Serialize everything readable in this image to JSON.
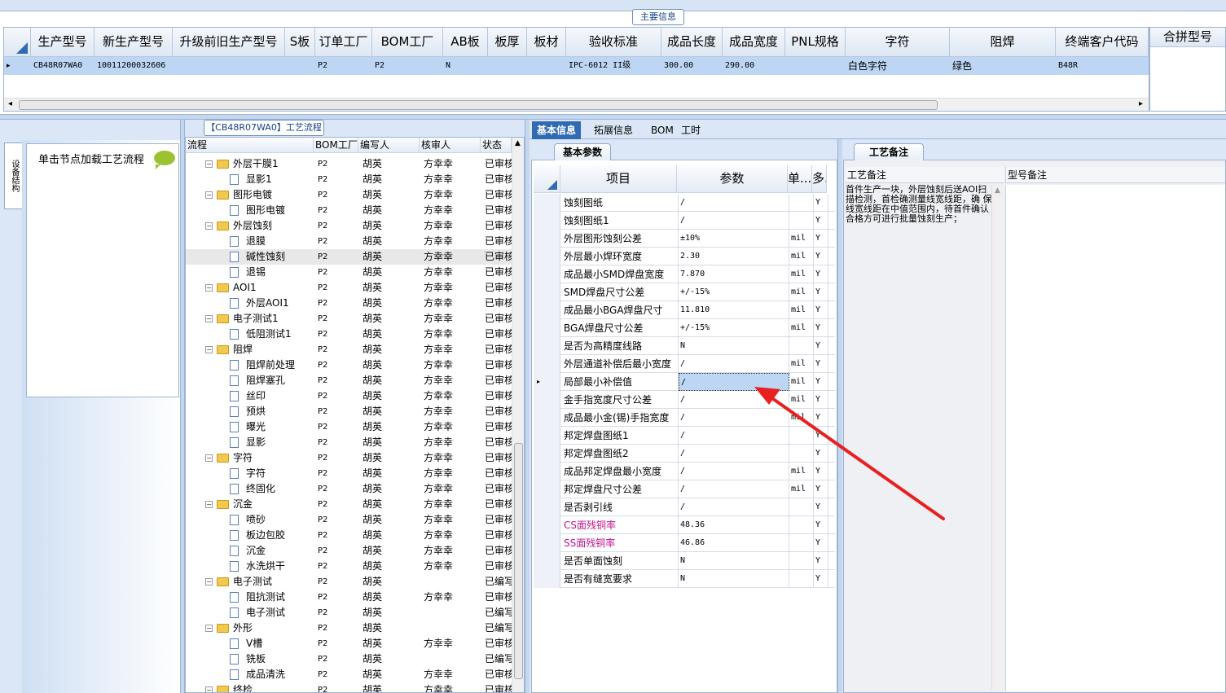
{
  "top": {
    "legend": "主要信息",
    "headers": [
      "生产型号",
      "新生产型号",
      "升级前旧生产型号",
      "S板",
      "订单工厂",
      "BOM工厂",
      "AB板",
      "板厚",
      "板材",
      "验收标准",
      "成品长度",
      "成品宽度",
      "PNL规格",
      "字符",
      "阻焊",
      "终端客户代码"
    ],
    "row": [
      "CB48R07WA0",
      "10011200032606",
      "",
      "",
      "P2",
      "P2",
      "N",
      "",
      "",
      "IPC-6012 II级",
      "300.00",
      "290.00",
      "",
      "白色字符",
      "绿色",
      "B48R"
    ],
    "merge_header": "合拼型号"
  },
  "left": {
    "side_tab": "设备结构",
    "load_hint": "单击节点加载工艺流程"
  },
  "flow": {
    "title": "【CB48R07WA0】工艺流程",
    "headers": [
      "流程",
      "BOM工厂",
      "编写人",
      "核审人",
      "状态"
    ],
    "rows": [
      {
        "name": "外层干膜1",
        "level": 0,
        "bom": "P2",
        "writer": "胡英",
        "reviewer": "方幸幸",
        "status": "已审核"
      },
      {
        "name": "显影1",
        "level": 1,
        "bom": "P2",
        "writer": "胡英",
        "reviewer": "方幸幸",
        "status": "已审核"
      },
      {
        "name": "图形电镀",
        "level": 0,
        "bom": "P2",
        "writer": "胡英",
        "reviewer": "方幸幸",
        "status": "已审核"
      },
      {
        "name": "图形电镀",
        "level": 1,
        "bom": "P2",
        "writer": "胡英",
        "reviewer": "方幸幸",
        "status": "已审核"
      },
      {
        "name": "外层蚀刻",
        "level": 0,
        "bom": "P2",
        "writer": "胡英",
        "reviewer": "方幸幸",
        "status": "已审核"
      },
      {
        "name": "退膜",
        "level": 1,
        "bom": "P2",
        "writer": "胡英",
        "reviewer": "方幸幸",
        "status": "已审核"
      },
      {
        "name": "碱性蚀刻",
        "level": 1,
        "bom": "P2",
        "writer": "胡英",
        "reviewer": "方幸幸",
        "status": "已审核",
        "selected": true
      },
      {
        "name": "退锡",
        "level": 1,
        "bom": "P2",
        "writer": "胡英",
        "reviewer": "方幸幸",
        "status": "已审核"
      },
      {
        "name": "AOI1",
        "level": 0,
        "bom": "P2",
        "writer": "胡英",
        "reviewer": "方幸幸",
        "status": "已审核"
      },
      {
        "name": "外层AOI1",
        "level": 1,
        "bom": "P2",
        "writer": "胡英",
        "reviewer": "方幸幸",
        "status": "已审核"
      },
      {
        "name": "电子测试1",
        "level": 0,
        "bom": "P2",
        "writer": "胡英",
        "reviewer": "方幸幸",
        "status": "已审核"
      },
      {
        "name": "低阻测试1",
        "level": 1,
        "bom": "P2",
        "writer": "胡英",
        "reviewer": "方幸幸",
        "status": "已审核"
      },
      {
        "name": "阻焊",
        "level": 0,
        "bom": "P2",
        "writer": "胡英",
        "reviewer": "方幸幸",
        "status": "已审核"
      },
      {
        "name": "阻焊前处理",
        "level": 1,
        "bom": "P2",
        "writer": "胡英",
        "reviewer": "方幸幸",
        "status": "已审核"
      },
      {
        "name": "阻焊塞孔",
        "level": 1,
        "bom": "P2",
        "writer": "胡英",
        "reviewer": "方幸幸",
        "status": "已审核"
      },
      {
        "name": "丝印",
        "level": 1,
        "bom": "P2",
        "writer": "胡英",
        "reviewer": "方幸幸",
        "status": "已审核"
      },
      {
        "name": "预烘",
        "level": 1,
        "bom": "P2",
        "writer": "胡英",
        "reviewer": "方幸幸",
        "status": "已审核"
      },
      {
        "name": "曝光",
        "level": 1,
        "bom": "P2",
        "writer": "胡英",
        "reviewer": "方幸幸",
        "status": "已审核"
      },
      {
        "name": "显影",
        "level": 1,
        "bom": "P2",
        "writer": "胡英",
        "reviewer": "方幸幸",
        "status": "已审核"
      },
      {
        "name": "字符",
        "level": 0,
        "bom": "P2",
        "writer": "胡英",
        "reviewer": "方幸幸",
        "status": "已审核"
      },
      {
        "name": "字符",
        "level": 1,
        "bom": "P2",
        "writer": "胡英",
        "reviewer": "方幸幸",
        "status": "已审核"
      },
      {
        "name": "终固化",
        "level": 1,
        "bom": "P2",
        "writer": "胡英",
        "reviewer": "方幸幸",
        "status": "已审核"
      },
      {
        "name": "沉金",
        "level": 0,
        "bom": "P2",
        "writer": "胡英",
        "reviewer": "方幸幸",
        "status": "已审核"
      },
      {
        "name": "喷砂",
        "level": 1,
        "bom": "P2",
        "writer": "胡英",
        "reviewer": "方幸幸",
        "status": "已审核"
      },
      {
        "name": "板边包胶",
        "level": 1,
        "bom": "P2",
        "writer": "胡英",
        "reviewer": "方幸幸",
        "status": "已审核"
      },
      {
        "name": "沉金",
        "level": 1,
        "bom": "P2",
        "writer": "胡英",
        "reviewer": "方幸幸",
        "status": "已审核"
      },
      {
        "name": "水洗烘干",
        "level": 1,
        "bom": "P2",
        "writer": "胡英",
        "reviewer": "方幸幸",
        "status": "已审核"
      },
      {
        "name": "电子测试",
        "level": 0,
        "bom": "P2",
        "writer": "胡英",
        "reviewer": "",
        "status": "已编写"
      },
      {
        "name": "阻抗测试",
        "level": 1,
        "bom": "P2",
        "writer": "胡英",
        "reviewer": "方幸幸",
        "status": "已审核"
      },
      {
        "name": "电子测试",
        "level": 1,
        "bom": "P2",
        "writer": "胡英",
        "reviewer": "",
        "status": "已编写"
      },
      {
        "name": "外形",
        "level": 0,
        "bom": "P2",
        "writer": "胡英",
        "reviewer": "",
        "status": "已编写"
      },
      {
        "name": "V槽",
        "level": 1,
        "bom": "P2",
        "writer": "胡英",
        "reviewer": "方幸幸",
        "status": "已审核"
      },
      {
        "name": "铣板",
        "level": 1,
        "bom": "P2",
        "writer": "胡英",
        "reviewer": "",
        "status": "已编写"
      },
      {
        "name": "成品清洗",
        "level": 1,
        "bom": "P2",
        "writer": "胡英",
        "reviewer": "方幸幸",
        "status": "已审核"
      },
      {
        "name": "终检",
        "level": 0,
        "bom": "P2",
        "writer": "胡英",
        "reviewer": "方幸幸",
        "status": "已审核"
      }
    ]
  },
  "right_tabs": [
    "基本信息",
    "拓展信息",
    "BOM",
    "工时"
  ],
  "params": {
    "tab": "基本参数",
    "headers": [
      "项目",
      "参数",
      "单...",
      "多..."
    ],
    "rows": [
      {
        "item": "蚀刻图纸",
        "value": "/",
        "unit": "",
        "flag": "Y"
      },
      {
        "item": "蚀刻图纸1",
        "value": "/",
        "unit": "",
        "flag": "Y"
      },
      {
        "item": "外层图形蚀刻公差",
        "value": "±10%",
        "unit": "mil",
        "flag": "Y"
      },
      {
        "item": "外层最小焊环宽度",
        "value": "2.30",
        "unit": "mil",
        "flag": "Y"
      },
      {
        "item": "成品最小SMD焊盘宽度",
        "value": "7.870",
        "unit": "mil",
        "flag": "Y"
      },
      {
        "item": "SMD焊盘尺寸公差",
        "value": "+/-15%",
        "unit": "mil",
        "flag": "Y"
      },
      {
        "item": "成品最小BGA焊盘尺寸",
        "value": "11.810",
        "unit": "mil",
        "flag": "Y"
      },
      {
        "item": "BGA焊盘尺寸公差",
        "value": "+/-15%",
        "unit": "mil",
        "flag": "Y"
      },
      {
        "item": "是否为高精度线路",
        "value": "N",
        "unit": "",
        "flag": "Y"
      },
      {
        "item": "外层通道补偿后最小宽度",
        "value": "/",
        "unit": "mil",
        "flag": "Y"
      },
      {
        "item": "局部最小补偿值",
        "value": "/",
        "unit": "mil",
        "flag": "Y",
        "selected": true
      },
      {
        "item": "金手指宽度尺寸公差",
        "value": "/",
        "unit": "mil",
        "flag": "Y"
      },
      {
        "item": "成品最小金(锡)手指宽度",
        "value": "/",
        "unit": "mil",
        "flag": "Y"
      },
      {
        "item": "邦定焊盘图纸1",
        "value": "/",
        "unit": "",
        "flag": "Y"
      },
      {
        "item": "邦定焊盘图纸2",
        "value": "/",
        "unit": "",
        "flag": "Y"
      },
      {
        "item": "成品邦定焊盘最小宽度",
        "value": "/",
        "unit": "mil",
        "flag": "Y"
      },
      {
        "item": "邦定焊盘尺寸公差",
        "value": "/",
        "unit": "mil",
        "flag": "Y"
      },
      {
        "item": "是否剥引线",
        "value": "/",
        "unit": "",
        "flag": "Y"
      },
      {
        "item": "CS面残铜率",
        "value": "48.36",
        "unit": "",
        "flag": "Y",
        "highlight": true
      },
      {
        "item": "SS面残铜率",
        "value": "46.86",
        "unit": "",
        "flag": "Y",
        "highlight": true
      },
      {
        "item": "是否单面蚀刻",
        "value": "N",
        "unit": "",
        "flag": "Y"
      },
      {
        "item": "是否有缝宽要求",
        "value": "N",
        "unit": "",
        "flag": "Y"
      }
    ]
  },
  "remarks": {
    "tab": "工艺备注",
    "left_header": "工艺备注",
    "right_header": "型号备注",
    "text": "首件生产一块，外层蚀刻后送AOI扫描检测，首检确测量线宽线距，确 保线宽线距在中值范围内，待首件确认合格方可进行批量蚀刻生产；"
  },
  "colors": {
    "accent": "#2f6ab3",
    "selected_row": "#bcd6f4",
    "arrow": "#e8201f",
    "pink_text": "#c0168e"
  }
}
